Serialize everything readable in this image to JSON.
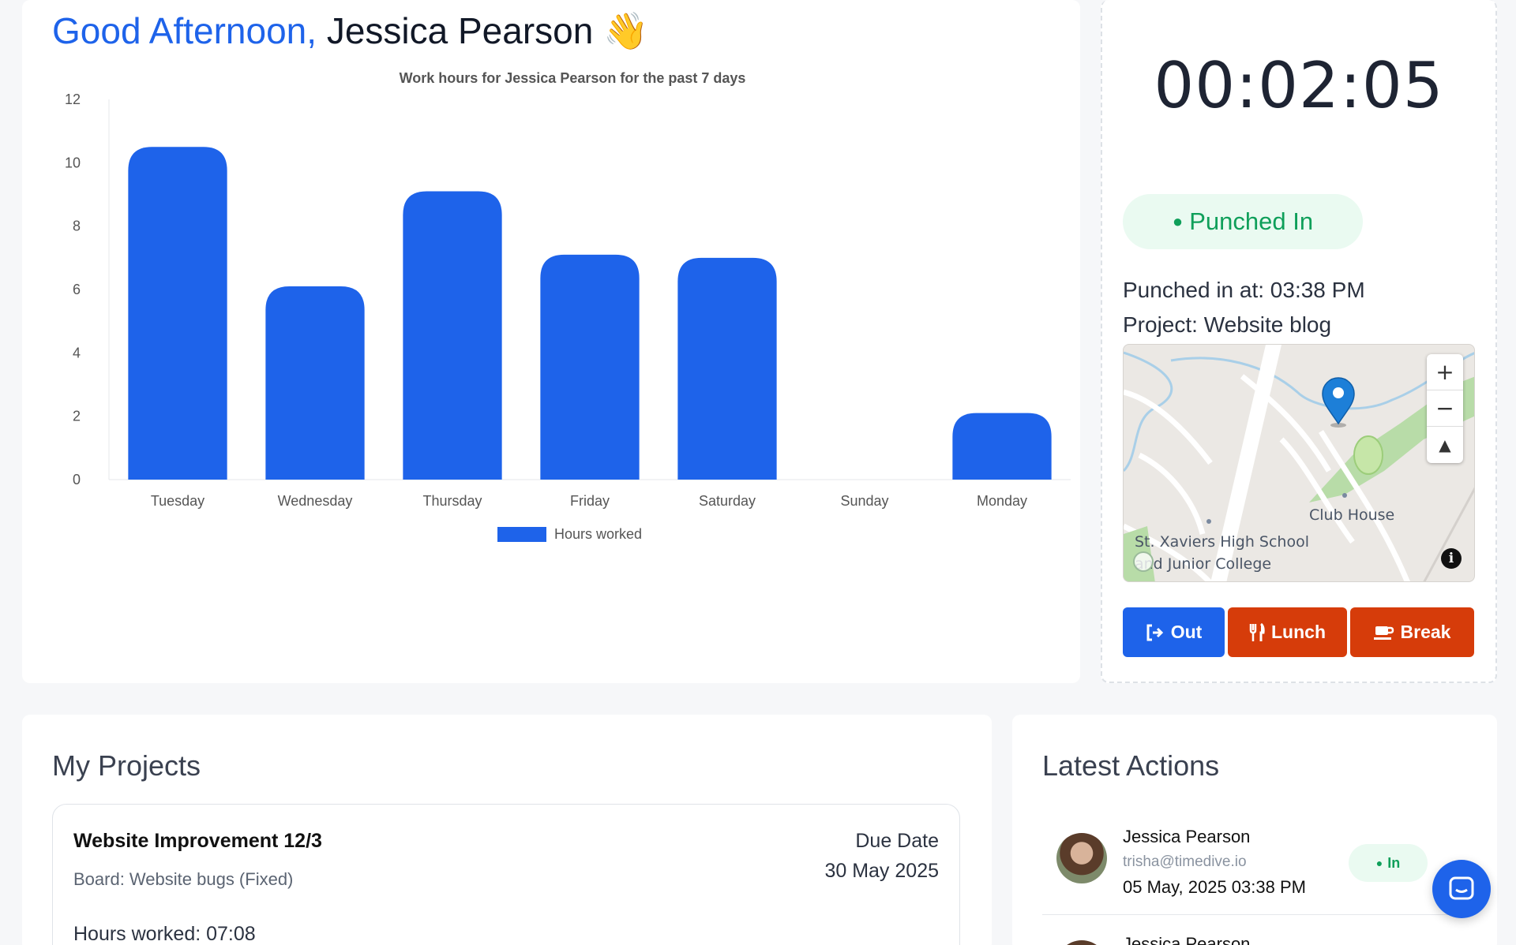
{
  "greeting": {
    "salutation": "Good Afternoon,",
    "user_name": "Jessica Pearson",
    "emoji": "👋"
  },
  "chart_data": {
    "type": "bar",
    "title": "Work hours for Jessica Pearson for the past 7 days",
    "categories": [
      "Tuesday",
      "Wednesday",
      "Thursday",
      "Friday",
      "Saturday",
      "Sunday",
      "Monday"
    ],
    "series": [
      {
        "name": "Hours worked",
        "values": [
          10.5,
          6.1,
          9.1,
          7.1,
          7.0,
          0,
          2.1
        ]
      }
    ],
    "ylim": [
      0,
      12
    ],
    "yticks": [
      0,
      2,
      4,
      6,
      8,
      10,
      12
    ],
    "xlabel": "",
    "ylabel": "",
    "grid": false,
    "legend_position": "bottom",
    "color": "#1e63ea"
  },
  "punch": {
    "timer": "00:02:05",
    "status": "Punched In",
    "punched_in_at": "Punched in at: 03:38 PM",
    "project": "Project: Website blog"
  },
  "map": {
    "labels": [
      "Club House",
      "St. Xaviers High School",
      "and Junior College"
    ],
    "zoom_in": "+",
    "zoom_out": "−",
    "compass": "▲",
    "info": "i"
  },
  "buttons": {
    "out": "Out",
    "lunch": "Lunch",
    "break": "Break"
  },
  "projects": {
    "title": "My Projects",
    "items": [
      {
        "name": "Website Improvement 12/3",
        "board": "Board: Website bugs (Fixed)",
        "hours": "Hours worked: 07:08",
        "due_label": "Due Date",
        "due_date": "30 May 2025"
      }
    ]
  },
  "actions": {
    "title": "Latest Actions",
    "items": [
      {
        "name": "Jessica Pearson",
        "email": "trisha@timedive.io",
        "time": "05 May, 2025 03:38 PM",
        "badge": "In"
      },
      {
        "name": "Jessica Pearson"
      }
    ]
  },
  "colors": {
    "primary": "#1e63ea",
    "danger": "#d63c0a",
    "success": "#0f9f5a"
  }
}
